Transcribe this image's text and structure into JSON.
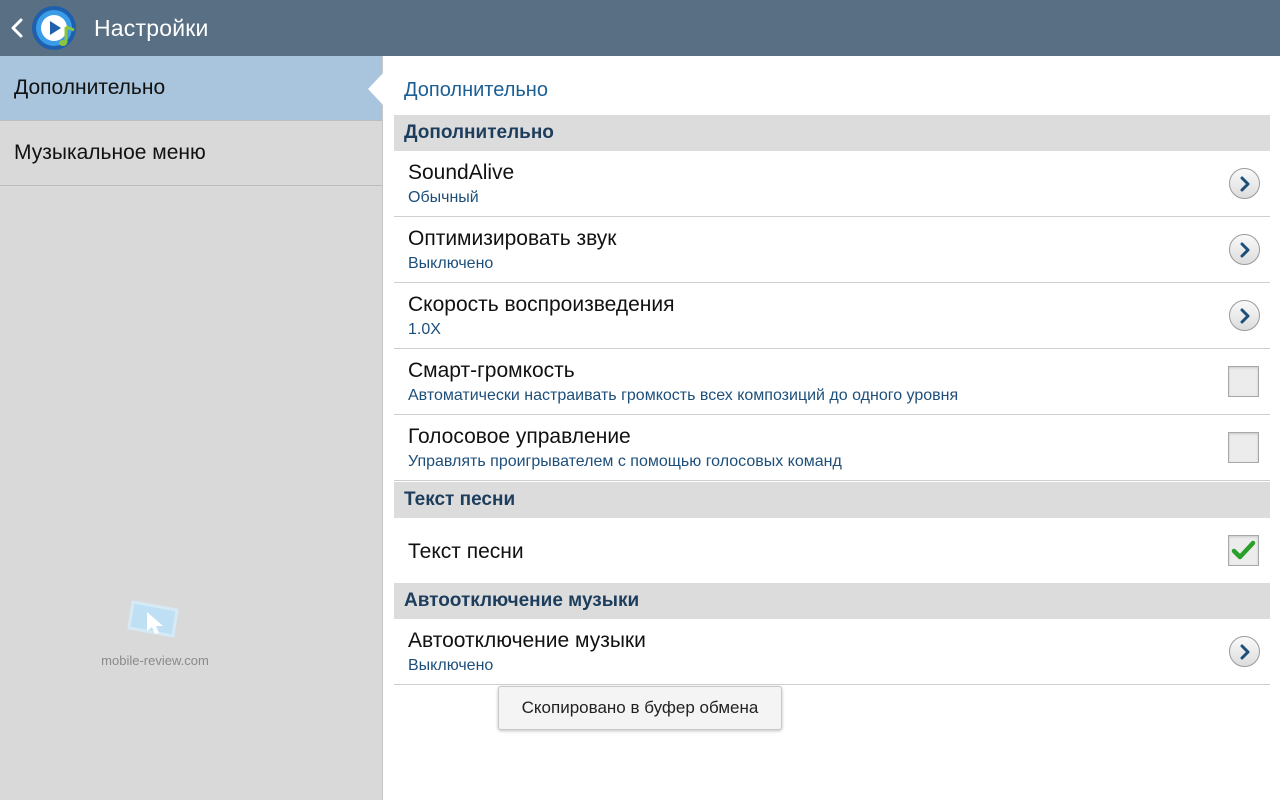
{
  "header": {
    "title": "Настройки"
  },
  "sidebar": {
    "items": [
      {
        "label": "Дополнительно",
        "selected": true
      },
      {
        "label": "Музыкальное меню",
        "selected": false
      }
    ]
  },
  "watermark": {
    "text": "mobile-review.com"
  },
  "main": {
    "title": "Дополнительно",
    "sections": [
      {
        "header": "Дополнительно",
        "rows": [
          {
            "title": "SoundAlive",
            "summary": "Обычный",
            "control": "arrow"
          },
          {
            "title": "Оптимизировать звук",
            "summary": "Выключено",
            "control": "arrow"
          },
          {
            "title": "Скорость воспроизведения",
            "summary": "1.0X",
            "control": "arrow"
          },
          {
            "title": "Смарт-громкость",
            "summary": "Автоматически настраивать громкость всех композиций до одного уровня",
            "control": "checkbox",
            "checked": false
          },
          {
            "title": "Голосовое управление",
            "summary": "Управлять проигрывателем с помощью голосовых команд",
            "control": "checkbox",
            "checked": false
          }
        ]
      },
      {
        "header": "Текст песни",
        "rows": [
          {
            "title": "Текст песни",
            "control": "checkbox",
            "checked": true
          }
        ]
      },
      {
        "header": "Автоотключение музыки",
        "rows": [
          {
            "title": "Автоотключение музыки",
            "summary": "Выключено",
            "control": "arrow"
          }
        ]
      }
    ]
  },
  "toast": {
    "text": "Скопировано в буфер обмена"
  },
  "colors": {
    "actionbar": "#586f84",
    "sidebar_selected": "#a9c4dd",
    "accent_text": "#1b5f95",
    "check_green": "#2aa02a"
  }
}
